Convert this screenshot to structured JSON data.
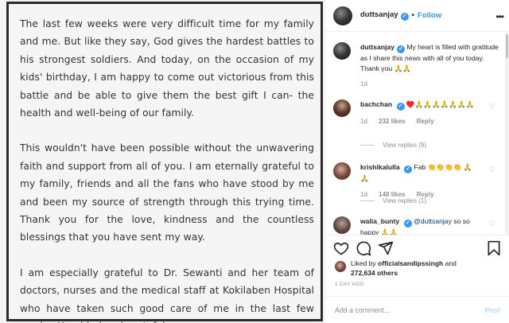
{
  "post": {
    "paragraphs": [
      "The last few weeks were very difficult time for my family and me. But like they say, God gives the hardest battles to his strongest soldiers. And today, on the occasion of my kids' birthday, I am happy to come out victorious from this battle and be able to give them the best gift I can- the health and well-being of our family.",
      "This wouldn't have been possible without the unwavering faith and support from all of you. I am eternally grateful to my family, friends and all the fans who have stood by me and been my source of strength through this trying time. Thank you for the love, kindness and the countless blessings that you have sent my way.",
      "I am especially grateful to Dr. Sewanti and her team of doctors, nurses and the medical staff at Kokilaben Hospital who have taken such good care of me in the last few weeks. Humbled and grateful."
    ]
  },
  "header": {
    "username": "duttsanjay",
    "separator": "•",
    "follow_label": "Follow",
    "more_icon": "more-options-icon"
  },
  "caption": {
    "username": "duttsanjay",
    "text": "My heart is filled with gratitude as I share this news with all of you today. Thank you 🙏🙏",
    "time": "1d"
  },
  "comments": [
    {
      "username": "bachchan",
      "text": "♥️🙏🙏🙏🙏🙏🙏🙏",
      "time": "1d",
      "likes": "232 likes",
      "reply_label": "Reply",
      "view_replies": "View replies (9)"
    },
    {
      "username": "krishikalulla",
      "text": "Fab 👏👏👏👏 🙏🙏",
      "time": "1d",
      "likes": "148 likes",
      "reply_label": "Reply",
      "view_replies": "View replies (1)"
    },
    {
      "username": "walia_bunty",
      "mention": "@duttsanjay",
      "text": "so so happy 🙏🙏"
    }
  ],
  "likes": {
    "prefix": "Liked by",
    "user": "officialsandipssingh",
    "conjunction": "and",
    "count": "272,634 others"
  },
  "time_ago": "1 DAY AGO",
  "add_comment": {
    "placeholder": "Add a comment...",
    "post_label": "Post"
  },
  "colors": {
    "accent": "#3897f0",
    "post_disabled": "#b2dffc",
    "muted": "#8e8e8e",
    "border": "#efefef"
  }
}
